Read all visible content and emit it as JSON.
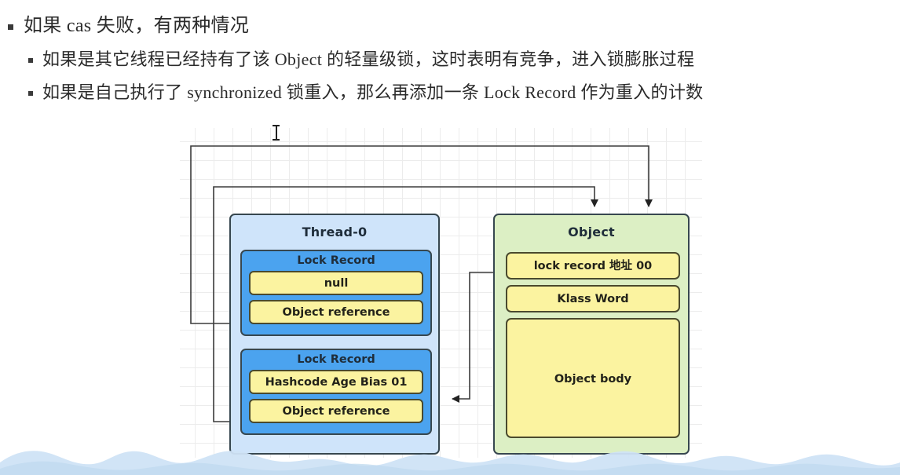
{
  "notes": [
    {
      "level": 1,
      "text": "如果 cas 失败，有两种情况"
    },
    {
      "level": 2,
      "text": "如果是其它线程已经持有了该 Object 的轻量级锁，这时表明有竞争，进入锁膨胀过程"
    },
    {
      "level": 2,
      "text": "如果是自己执行了 synchronized 锁重入，那么再添加一条 Lock Record 作为重入的计数"
    }
  ],
  "diagram": {
    "thread": {
      "title": "Thread-0",
      "lock_records": [
        {
          "title": "Lock Record",
          "rows": [
            "null",
            "Object reference"
          ]
        },
        {
          "title": "Lock Record",
          "rows": [
            "Hashcode Age Bias 01",
            "Object reference"
          ]
        }
      ]
    },
    "object": {
      "title": "Object",
      "rows": [
        "lock record 地址 00",
        "Klass Word",
        "Object body"
      ]
    },
    "connectors": [
      {
        "name": "object-reference-1-to-object",
        "from": "Lock Record 1 / Object reference",
        "to": "Object (top)"
      },
      {
        "name": "object-reference-2-to-object",
        "from": "Lock Record 2 / Object reference",
        "to": "Object (top)"
      },
      {
        "name": "object-lock-record-to-thread",
        "from": "Object / lock record 地址 00",
        "to": "Lock Record 2"
      }
    ]
  },
  "colors": {
    "thread_fill": "#cfe4fa",
    "lock_record_fill": "#4ba3ef",
    "cell_fill": "#fbf3a0",
    "object_fill": "#dcefc4",
    "stroke": "#37474f",
    "wave": "#cfe3f5"
  },
  "cursor": {
    "type": "text-caret"
  }
}
